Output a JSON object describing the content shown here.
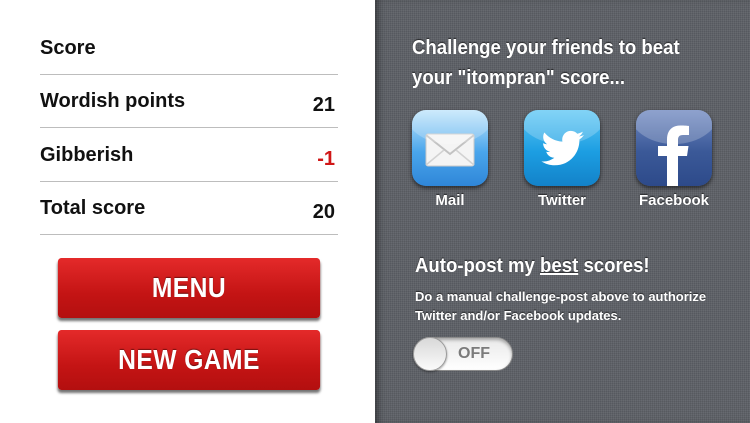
{
  "score_table": {
    "rows": [
      {
        "label": "Score",
        "value": ""
      },
      {
        "label": "Wordish points",
        "value": "21"
      },
      {
        "label": "Gibberish",
        "value": "-1"
      },
      {
        "label": "Total score",
        "value": "20"
      }
    ]
  },
  "buttons": {
    "menu": "MENU",
    "new_game": "NEW GAME"
  },
  "share": {
    "challenge_text": "Challenge your friends to beat your \"itompran\" score...",
    "targets": [
      {
        "label": "Mail",
        "icon": "mail-icon"
      },
      {
        "label": "Twitter",
        "icon": "twitter-icon"
      },
      {
        "label": "Facebook",
        "icon": "facebook-icon"
      }
    ]
  },
  "autopost": {
    "prefix": "Auto-post my ",
    "emphasis": "best",
    "suffix": " scores!",
    "note": "Do a manual challenge-post above to authorize Twitter and/or Facebook updates.",
    "toggle_label": "OFF",
    "toggle_on": false
  },
  "colors": {
    "accent_red": "#c41414",
    "negative": "#d01616",
    "panel": "#5d6066"
  }
}
